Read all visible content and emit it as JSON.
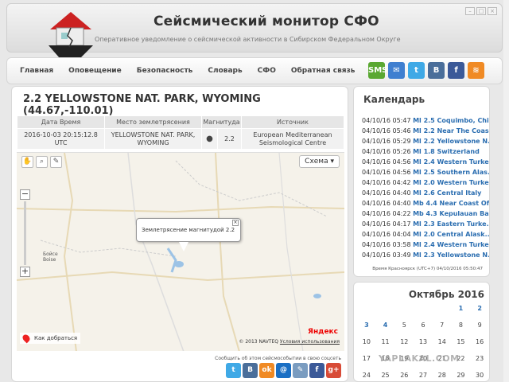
{
  "header": {
    "title": "Сейсмический монитор СФО",
    "subtitle": "Оперативное уведомление о сейсмической активности в Сибирском Федеральном Округе"
  },
  "nav": [
    "Главная",
    "Оповещение",
    "Безопасность",
    "Словарь",
    "СФО",
    "Обратная связь"
  ],
  "social": [
    {
      "name": "sms-icon",
      "label": "SMS",
      "color": "#5aa832"
    },
    {
      "name": "mail-icon",
      "label": "✉",
      "color": "#3f7fd0"
    },
    {
      "name": "twitter-icon",
      "label": "t",
      "color": "#3fa9e6"
    },
    {
      "name": "vk-icon",
      "label": "B",
      "color": "#4a6e9a"
    },
    {
      "name": "facebook-icon",
      "label": "f",
      "color": "#3b5998"
    },
    {
      "name": "rss-icon",
      "label": "≋",
      "color": "#f08a24"
    }
  ],
  "event": {
    "title": "2.2 YELLOWSTONE NAT. PARK, WYOMING (44.67,-110.01)",
    "columns": [
      "Дата Время",
      "Место землетрясения",
      "Магнитуда",
      "Источник"
    ],
    "datetime": "2016-10-03 20:15:12.8 UTC",
    "place_line1": "YELLOWSTONE NAT. PARK,",
    "place_line2": "WYOMING",
    "magnitude_dot": "●",
    "magnitude": "2.2",
    "source_line1": "European Mediterranean",
    "source_line2": "Seismological Centre"
  },
  "map": {
    "schema_label": "Схема ▾",
    "popup_text": "Землетрясение магнитудой 2.2",
    "city_line1": "Бойсе",
    "city_line2": "Boise",
    "route_label": "Как добраться",
    "copyright": "© 2013 NAVTEQ",
    "terms": "Условия использования",
    "yandex": "Яндекс"
  },
  "share": {
    "label": "Сообщить об этом сейсмособытии в свою соцсеть",
    "icons": [
      {
        "name": "twitter-share-icon",
        "label": "t",
        "color": "#3fa9e6"
      },
      {
        "name": "vk-share-icon",
        "label": "B",
        "color": "#4a6e9a"
      },
      {
        "name": "odnoklassniki-share-icon",
        "label": "ok",
        "color": "#f08a24"
      },
      {
        "name": "moimir-share-icon",
        "label": "@",
        "color": "#1a6fc4"
      },
      {
        "name": "livejournal-share-icon",
        "label": "✎",
        "color": "#7a9cc0"
      },
      {
        "name": "facebook-share-icon",
        "label": "f",
        "color": "#3b5998"
      },
      {
        "name": "googleplus-share-icon",
        "label": "g+",
        "color": "#d84b37"
      }
    ]
  },
  "sidebar": {
    "title": "Календарь",
    "events": [
      {
        "time": "04/10/16 05:47",
        "text": "Ml 2.5 Coquimbo, Chi..."
      },
      {
        "time": "04/10/16 05:46",
        "text": "Ml 2.2 Near The Coas..."
      },
      {
        "time": "04/10/16 05:29",
        "text": "Ml 2.2 Yellowstone N..."
      },
      {
        "time": "04/10/16 05:26",
        "text": "Ml 1.8 Switzerland"
      },
      {
        "time": "04/10/16 04:56",
        "text": "Ml 2.4 Western Turke..."
      },
      {
        "time": "04/10/16 04:56",
        "text": "Ml 2.5 Southern Alas..."
      },
      {
        "time": "04/10/16 04:42",
        "text": "Ml 2.0 Western Turke..."
      },
      {
        "time": "04/10/16 04:40",
        "text": "Ml 2.6 Central Italy"
      },
      {
        "time": "04/10/16 04:40",
        "text": "Mb 4.4 Near Coast Of..."
      },
      {
        "time": "04/10/16 04:22",
        "text": "Mb 4.3 Kepulauan Bar..."
      },
      {
        "time": "04/10/16 04:17",
        "text": "Ml 2.3 Eastern Turke..."
      },
      {
        "time": "04/10/16 04:04",
        "text": "Ml 2.0 Central Alask..."
      },
      {
        "time": "04/10/16 03:58",
        "text": "Ml 2.4 Western Turke..."
      },
      {
        "time": "04/10/16 03:49",
        "text": "Ml 2.3 Yellowstone N..."
      }
    ],
    "timezone": "Время Красноярск (UTC+7) 04/10/2016 05:50:47"
  },
  "calendar": {
    "title": "Октябрь 2016",
    "cells": [
      {
        "d": "",
        "link": false
      },
      {
        "d": "",
        "link": false
      },
      {
        "d": "",
        "link": false
      },
      {
        "d": "",
        "link": false
      },
      {
        "d": "",
        "link": false
      },
      {
        "d": "1",
        "link": true
      },
      {
        "d": "2",
        "link": true
      },
      {
        "d": "3",
        "link": true
      },
      {
        "d": "4",
        "link": true
      },
      {
        "d": "5",
        "link": false
      },
      {
        "d": "6",
        "link": false
      },
      {
        "d": "7",
        "link": false
      },
      {
        "d": "8",
        "link": false
      },
      {
        "d": "9",
        "link": false
      },
      {
        "d": "10",
        "link": false
      },
      {
        "d": "11",
        "link": false
      },
      {
        "d": "12",
        "link": false
      },
      {
        "d": "13",
        "link": false
      },
      {
        "d": "14",
        "link": false
      },
      {
        "d": "15",
        "link": false
      },
      {
        "d": "16",
        "link": false
      },
      {
        "d": "17",
        "link": false
      },
      {
        "d": "18",
        "link": false
      },
      {
        "d": "19",
        "link": false
      },
      {
        "d": "20",
        "link": false
      },
      {
        "d": "21",
        "link": false
      },
      {
        "d": "22",
        "link": false
      },
      {
        "d": "23",
        "link": false
      },
      {
        "d": "24",
        "link": false
      },
      {
        "d": "25",
        "link": false
      },
      {
        "d": "26",
        "link": false
      },
      {
        "d": "27",
        "link": false
      },
      {
        "d": "28",
        "link": false
      },
      {
        "d": "29",
        "link": false
      },
      {
        "d": "30",
        "link": false
      }
    ]
  },
  "watermark": "YAPLAKAL.COM"
}
